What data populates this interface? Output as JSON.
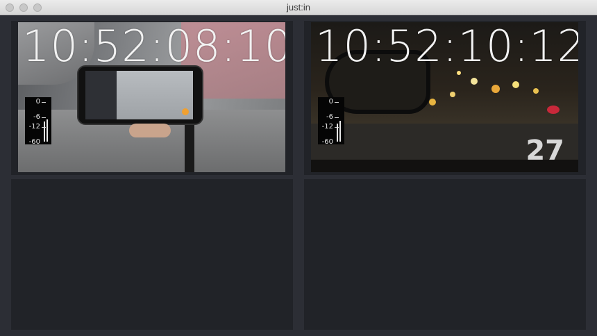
{
  "window": {
    "title": "just:in"
  },
  "titlebar": {
    "buttons": [
      "close-button",
      "minimize-button",
      "zoom-button"
    ]
  },
  "cells": [
    {
      "timecode": "10:52:08:10",
      "meter_labels": [
        "0",
        "-6",
        "-12",
        "-60"
      ],
      "audio_levels": [
        0.55,
        0.62
      ]
    },
    {
      "timecode": "10:52:10:12",
      "meter_labels": [
        "0",
        "-6",
        "-12",
        "-60"
      ],
      "audio_levels": [
        0.5,
        0.58
      ],
      "road_marking": "27"
    },
    {
      "empty": true
    },
    {
      "empty": true
    }
  ],
  "colors": {
    "background": "#2c2e35",
    "cell": "#212328",
    "timecode": "#f2f2f2",
    "record_dot": "#f0a030"
  }
}
